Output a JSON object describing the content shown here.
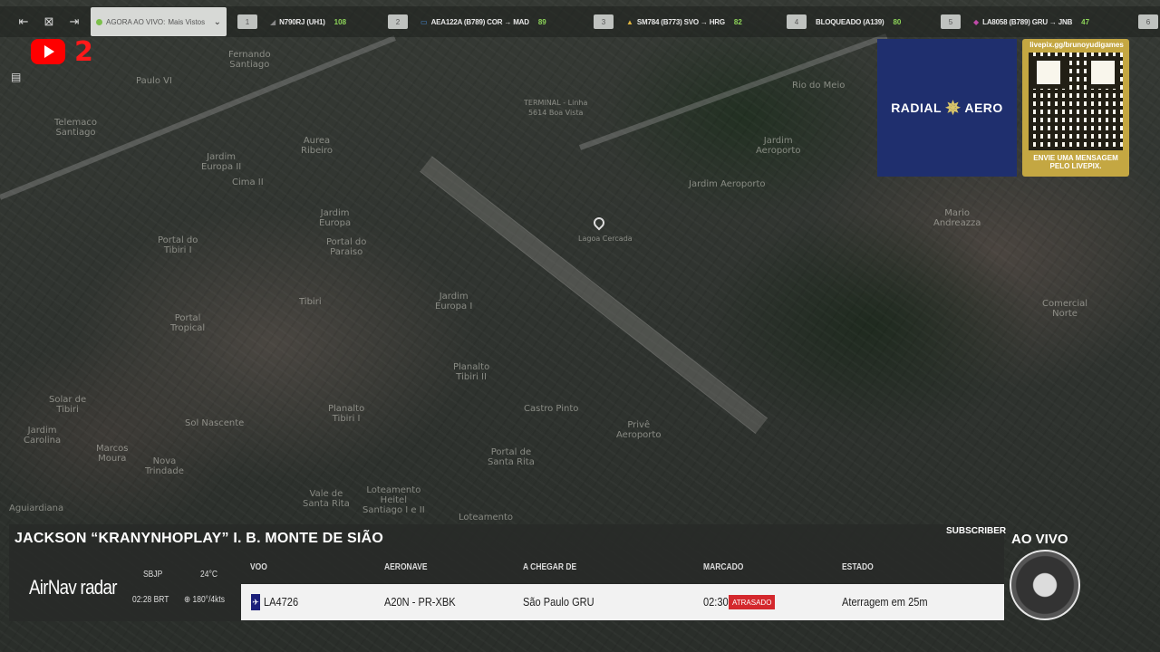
{
  "topbar": {
    "live_label": "AGORA AO VIVO:",
    "live_selected": "Mais Vistos",
    "flights": [
      {
        "num": "1",
        "text": "N790RJ (UH1)",
        "count": "108"
      },
      {
        "num": "2",
        "text": "AEA122A (B789)  COR → MAD",
        "count": "89"
      },
      {
        "num": "3",
        "text": "SM784 (B773)  SVO → HRG",
        "count": "82"
      },
      {
        "num": "4",
        "text": "BLOQUEADO (A139)",
        "count": "80"
      },
      {
        "num": "5",
        "text": "LA8058 (B789)  GRU → JNB",
        "count": "47"
      },
      {
        "num": "6",
        "text": "",
        "count": ""
      }
    ]
  },
  "youtube_badge": "2",
  "map": {
    "places": [
      "Fernando\nSantiago",
      "Paulo VI",
      "Telemaco\nSantiago",
      "Aurea\nRibeiro",
      "Jardim\nEuropa II",
      "Cima II",
      "Jardim\nEuropa",
      "Portal do\nTibiri I",
      "Portal do\nParaiso",
      "Tibiri",
      "Jardim\nEuropa I",
      "Portal\nTropical",
      "Planalto\nTibiri II",
      "Castro Pinto",
      "Solar de\nTibiri",
      "Sol Nascente",
      "Planalto\nTibiri I",
      "Portal de\nSanta Rita",
      "Jardim\nCarolina",
      "Marcos\nMoura",
      "Nova\nTrindade",
      "Vale de\nSanta Rita",
      "Loteamento\nHeitel\nSantiago I e II",
      "Privê\nAeroporto",
      "Rio do Meio",
      "Jardim\nAeroporto",
      "Jardim Aeroporto",
      "Mario\nAndreazza",
      "Comercial\nNorte",
      "Aguiardiana",
      "Loteamento",
      "TERMINAL - Linha\n5614 Boa Vista",
      "Lagoa Cercada"
    ]
  },
  "sponsor": {
    "radial_left": "RADIAL",
    "radial_right": "AERO",
    "qr_url": "livepix.gg/brunoyudigames",
    "qr_caption": "ENVIE UMA MENSAGEM\nPELO LIVEPIX."
  },
  "panel": {
    "streamer": "JACKSON “KRANYNHOPLAY” I. B. MONTE DE SIÃO",
    "subscriber": "SUBSCRIBER",
    "brand": "AirNav radar",
    "airport": "SBJP",
    "temperature": "24°C",
    "time": "02:28 BRT",
    "wind": "⊕ 180°/4kts",
    "headers": {
      "flight": "VOO",
      "aircraft": "AERONAVE",
      "from": "A CHEGAR DE",
      "scheduled": "MARCADO",
      "status": "ESTADO"
    },
    "row": {
      "airline_tag": "✈",
      "flight": "LA4726",
      "aircraft": "A20N - PR-XBK",
      "from": "São Paulo GRU",
      "scheduled": "02:30",
      "delayed": "ATRASADO",
      "status": "Aterragem em 25m"
    }
  },
  "live_badge": "AO VIVO",
  "colors": {
    "accent_green": "#8fd65a",
    "delay_red": "#d4282d",
    "youtube_red": "#ff0000",
    "sponsor_navy": "#1f2f6e",
    "sponsor_gold": "#c4a742"
  }
}
